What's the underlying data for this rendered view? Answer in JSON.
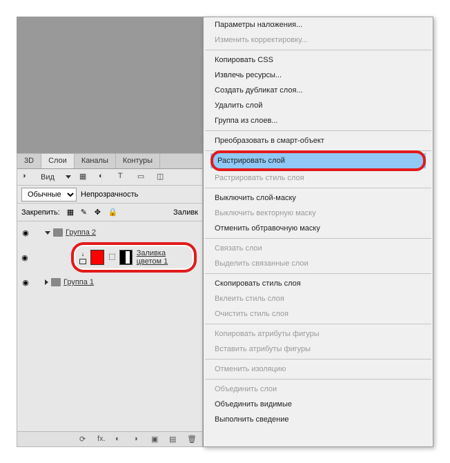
{
  "panel": {
    "tabs": [
      "3D",
      "Слои",
      "Каналы",
      "Контуры"
    ],
    "view_label": "Вид",
    "blend": {
      "label": "",
      "value": "Обычные"
    },
    "opacity_label": "Непрозрачность",
    "lock_label": "Закрепить:",
    "fill_label": "Заливк"
  },
  "layers": {
    "group2": "Группа 2",
    "fill_layer": "Заливка цветом 1",
    "group1": "Группа 1"
  },
  "menu": {
    "blending": "Параметры наложения...",
    "edit_adjust": "Изменить корректировку...",
    "copy_css": "Копировать CSS",
    "extract": "Извлечь ресурсы...",
    "duplicate": "Создать дубликат слоя...",
    "delete": "Удалить слой",
    "group": "Группа из слоев...",
    "smart": "Преобразовать в смарт-объект",
    "raster": "Растрировать слой",
    "raster_style": "Растрировать стиль слоя",
    "disable_mask": "Выключить слой-маску",
    "disable_vec": "Выключить векторную маску",
    "release_clip": "Отменить обтравочную маску",
    "link": "Связать слои",
    "select_linked": "Выделить связанные слои",
    "copy_style": "Скопировать стиль слоя",
    "paste_style": "Вклеить стиль слоя",
    "clear_style": "Очистить стиль слоя",
    "copy_shape": "Копировать атрибуты фигуры",
    "paste_shape": "Вставить атрибуты фигуры",
    "cancel_iso": "Отменить изоляцию",
    "merge": "Объединить слои",
    "merge_vis": "Объединить видимые",
    "flatten": "Выполнить сведение"
  },
  "icons": {
    "eye": "◉",
    "view": "◑",
    "filter": "▼",
    "link": "⧉",
    "fx": "fx.",
    "mask": "◐",
    "adj": "�◑",
    "folder": "▣",
    "new": "▤",
    "trash": "🗑"
  }
}
